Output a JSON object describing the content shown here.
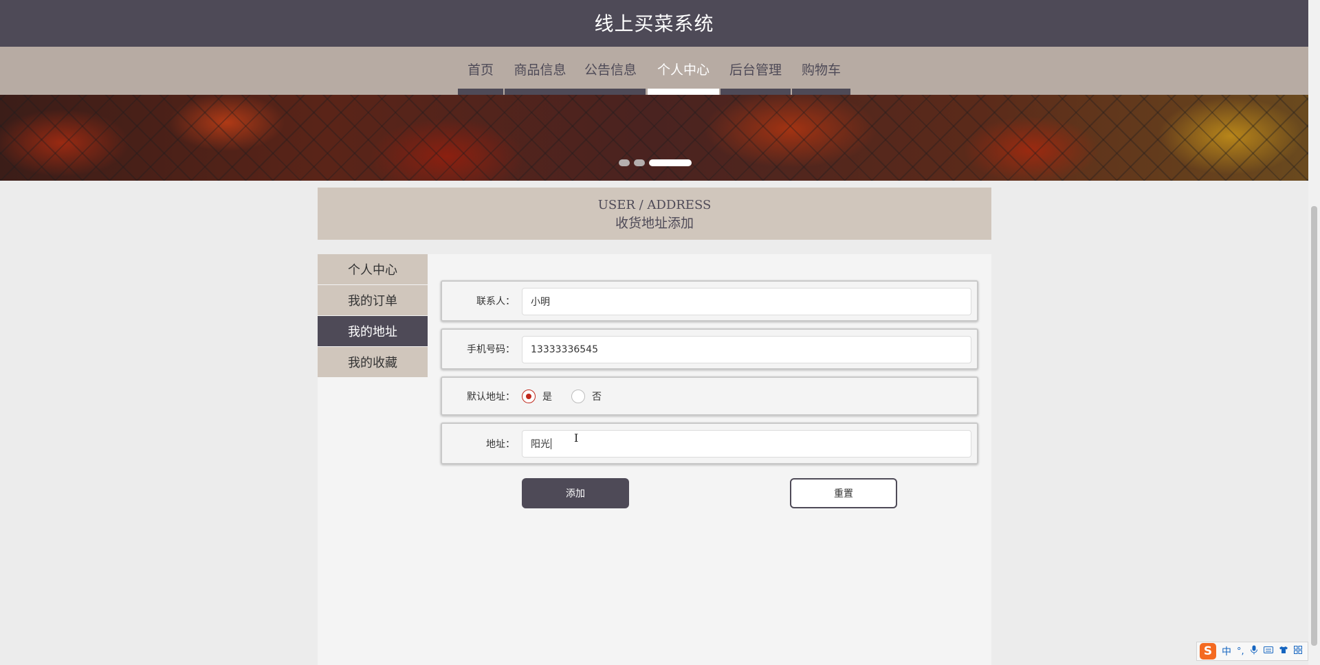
{
  "header": {
    "title": "线上买菜系统"
  },
  "nav": {
    "items": [
      {
        "label": "首页"
      },
      {
        "label": "商品信息"
      },
      {
        "label": "公告信息"
      },
      {
        "label": "个人中心",
        "active": true
      },
      {
        "label": "后台管理"
      },
      {
        "label": "购物车"
      }
    ]
  },
  "banner": {
    "slides": 3,
    "active_slide": 3
  },
  "section": {
    "title_en": "USER / ADDRESS",
    "title_cn": "收货地址添加"
  },
  "side_menu": {
    "items": [
      {
        "label": "个人中心"
      },
      {
        "label": "我的订单"
      },
      {
        "label": "我的地址",
        "active": true
      },
      {
        "label": "我的收藏"
      }
    ]
  },
  "form": {
    "contact": {
      "label": "联系人：",
      "value": "小明"
    },
    "phone": {
      "label": "手机号码：",
      "value": "13333336545"
    },
    "default_address": {
      "label": "默认地址：",
      "options": [
        {
          "label": "是",
          "checked": true
        },
        {
          "label": "否",
          "checked": false
        }
      ]
    },
    "address": {
      "label": "地址：",
      "value": "阳光"
    },
    "add_button": "添加",
    "reset_button": "重置"
  },
  "ime": {
    "logo": "S",
    "mode": "中",
    "punct": "°,",
    "icons": [
      "microphone-icon",
      "keyboard-icon",
      "skin-icon",
      "apps-icon"
    ]
  },
  "colors": {
    "header_bg": "#4e4a57",
    "nav_bg": "#b7aba3",
    "panel_accent": "#d0c6bc",
    "radio_checked": "#c0281c"
  }
}
